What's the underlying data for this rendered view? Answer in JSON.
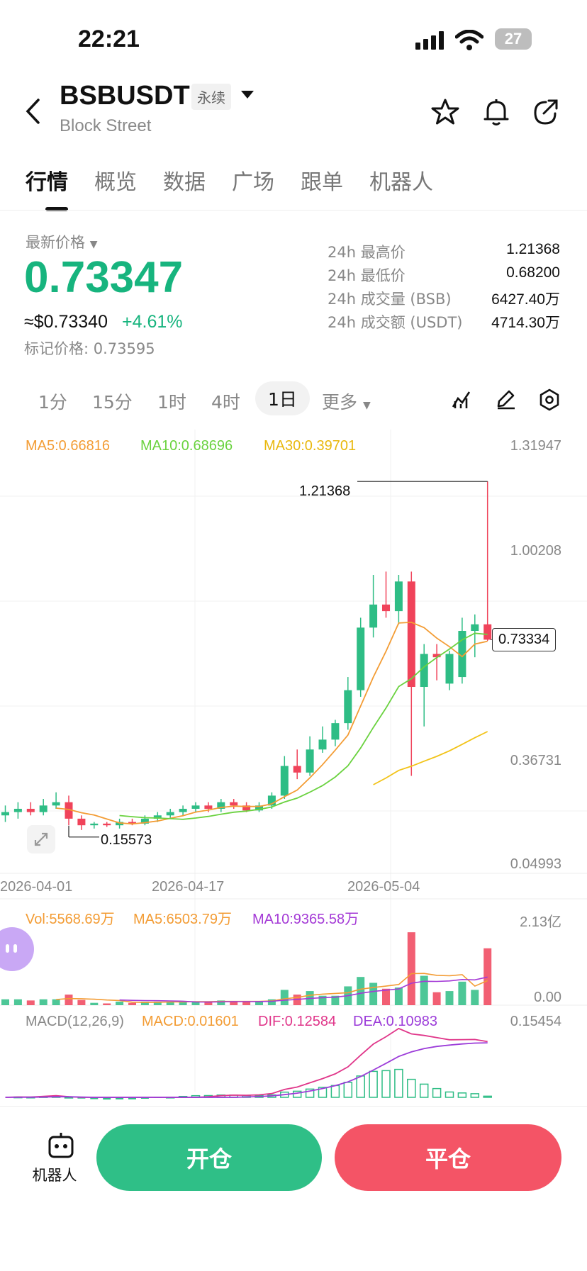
{
  "status": {
    "time": "22:21",
    "battery": "27"
  },
  "header": {
    "pair": "BSBUSDT",
    "tag": "永续",
    "exchange": "Block Street"
  },
  "tabs": [
    "行情",
    "概览",
    "数据",
    "广场",
    "跟单",
    "机器人"
  ],
  "price": {
    "label": "最新价格",
    "last": "0.73347",
    "usd": "≈$0.73340",
    "change": "+4.61%",
    "mark": "标记价格: 0.73595"
  },
  "stats": [
    {
      "label": "24h 最高价",
      "value": "1.21368"
    },
    {
      "label": "24h 最低价",
      "value": "0.68200"
    },
    {
      "label": "24h 成交量 (BSB)",
      "value": "6427.40万"
    },
    {
      "label": "24h 成交额 (USDT)",
      "value": "4714.30万"
    }
  ],
  "intervals": [
    "1分",
    "15分",
    "1时",
    "4时",
    "1日",
    "更多"
  ],
  "active_interval": "1日",
  "indicators": {
    "ma5": "MA5:0.66816",
    "ma10": "MA10:0.68696",
    "ma30": "MA30:0.39701",
    "vol": "Vol:5568.69万",
    "vma5": "MA5:6503.79万",
    "vma10": "MA10:9365.58万",
    "macd_label": "MACD(12,26,9)",
    "macd": "MACD:0.01601",
    "dif": "DIF:0.12584",
    "dea": "DEA:0.10983"
  },
  "axes": {
    "price_ticks": [
      "1.31947",
      "1.00208",
      "0.36731",
      "0.04993"
    ],
    "vol_ticks": [
      "2.13亿",
      "0.00"
    ],
    "macd_tick": "0.15454",
    "dates": [
      "2026-04-01",
      "2026-04-17",
      "2026-05-04"
    ],
    "current": "0.73334",
    "high_callout": "1.21368",
    "low_callout": "0.15573"
  },
  "colors": {
    "up": "#2ebd85",
    "down": "#f0435a",
    "ma5": "#f39c34",
    "ma10": "#6ad23f",
    "ma30": "#f2c318",
    "vma10": "#a43ad6",
    "dif": "#e0368a",
    "dea": "#9c3cd9"
  },
  "chart_data": {
    "type": "candlestick",
    "ylim": [
      0.04993,
      1.31947
    ],
    "candles": [
      {
        "o": 0.2,
        "h": 0.23,
        "l": 0.18,
        "c": 0.21
      },
      {
        "o": 0.21,
        "h": 0.24,
        "l": 0.19,
        "c": 0.22
      },
      {
        "o": 0.22,
        "h": 0.24,
        "l": 0.2,
        "c": 0.21
      },
      {
        "o": 0.21,
        "h": 0.25,
        "l": 0.2,
        "c": 0.23
      },
      {
        "o": 0.23,
        "h": 0.27,
        "l": 0.22,
        "c": 0.24
      },
      {
        "o": 0.24,
        "h": 0.26,
        "l": 0.17,
        "c": 0.19
      },
      {
        "o": 0.19,
        "h": 0.2,
        "l": 0.15573,
        "c": 0.17
      },
      {
        "o": 0.17,
        "h": 0.18,
        "l": 0.16,
        "c": 0.175
      },
      {
        "o": 0.175,
        "h": 0.18,
        "l": 0.165,
        "c": 0.17
      },
      {
        "o": 0.17,
        "h": 0.19,
        "l": 0.16,
        "c": 0.18
      },
      {
        "o": 0.18,
        "h": 0.19,
        "l": 0.17,
        "c": 0.175
      },
      {
        "o": 0.175,
        "h": 0.2,
        "l": 0.17,
        "c": 0.19
      },
      {
        "o": 0.19,
        "h": 0.21,
        "l": 0.18,
        "c": 0.2
      },
      {
        "o": 0.2,
        "h": 0.22,
        "l": 0.19,
        "c": 0.21
      },
      {
        "o": 0.21,
        "h": 0.23,
        "l": 0.2,
        "c": 0.22
      },
      {
        "o": 0.22,
        "h": 0.24,
        "l": 0.21,
        "c": 0.23
      },
      {
        "o": 0.23,
        "h": 0.24,
        "l": 0.21,
        "c": 0.22
      },
      {
        "o": 0.22,
        "h": 0.25,
        "l": 0.21,
        "c": 0.24
      },
      {
        "o": 0.24,
        "h": 0.25,
        "l": 0.22,
        "c": 0.23
      },
      {
        "o": 0.23,
        "h": 0.24,
        "l": 0.21,
        "c": 0.215
      },
      {
        "o": 0.215,
        "h": 0.24,
        "l": 0.21,
        "c": 0.23
      },
      {
        "o": 0.23,
        "h": 0.27,
        "l": 0.22,
        "c": 0.26
      },
      {
        "o": 0.26,
        "h": 0.38,
        "l": 0.25,
        "c": 0.35
      },
      {
        "o": 0.35,
        "h": 0.4,
        "l": 0.31,
        "c": 0.33
      },
      {
        "o": 0.33,
        "h": 0.44,
        "l": 0.32,
        "c": 0.4
      },
      {
        "o": 0.4,
        "h": 0.47,
        "l": 0.39,
        "c": 0.43
      },
      {
        "o": 0.43,
        "h": 0.49,
        "l": 0.41,
        "c": 0.48
      },
      {
        "o": 0.48,
        "h": 0.62,
        "l": 0.46,
        "c": 0.58
      },
      {
        "o": 0.58,
        "h": 0.8,
        "l": 0.56,
        "c": 0.77
      },
      {
        "o": 0.77,
        "h": 0.93,
        "l": 0.74,
        "c": 0.84
      },
      {
        "o": 0.84,
        "h": 0.94,
        "l": 0.8,
        "c": 0.82
      },
      {
        "o": 0.82,
        "h": 0.93,
        "l": 0.78,
        "c": 0.91
      },
      {
        "o": 0.91,
        "h": 0.94,
        "l": 0.32,
        "c": 0.59
      },
      {
        "o": 0.59,
        "h": 0.72,
        "l": 0.47,
        "c": 0.69
      },
      {
        "o": 0.69,
        "h": 0.72,
        "l": 0.61,
        "c": 0.68
      },
      {
        "o": 0.6,
        "h": 0.7,
        "l": 0.58,
        "c": 0.69
      },
      {
        "o": 0.62,
        "h": 0.8,
        "l": 0.6,
        "c": 0.76
      },
      {
        "o": 0.76,
        "h": 0.81,
        "l": 0.68,
        "c": 0.78
      },
      {
        "o": 0.78,
        "h": 1.21368,
        "l": 0.73,
        "c": 0.73334
      }
    ]
  }
}
